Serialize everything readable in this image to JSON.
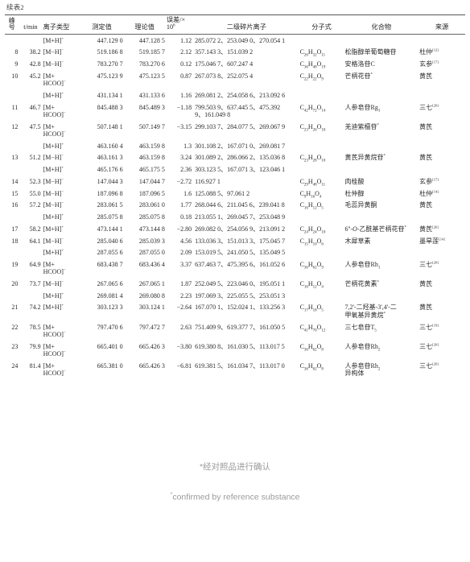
{
  "document": {
    "continuation_label": "续表2"
  },
  "table": {
    "headers": {
      "peak_no_line1": "峰",
      "peak_no_line2": "号",
      "retention_time": "t/min",
      "ion_type": "离子类型",
      "measured": "测定值",
      "theoretical": "理论值",
      "error_line1": "误差/×",
      "error_line2": "10",
      "error_exp": "6",
      "fragments": "二级碎片离子",
      "formula": "分子式",
      "compound": "化合物",
      "source": "来源"
    },
    "rows": [
      {
        "no": "",
        "rt": "",
        "ion": "[M+H]",
        "ion_sup": "+",
        "ion_line2": "",
        "measured": "447.129 0",
        "theoretical": "447.128 5",
        "error": "1.12",
        "fragments": "285.072 2、253.049 0、270.054 1",
        "formula": "",
        "formula_parts": [],
        "compound": "",
        "compound_star": false,
        "compound_line2": "",
        "source": "",
        "source_ref": ""
      },
      {
        "no": "8",
        "rt": "38.2",
        "ion": "[M−H]",
        "ion_sup": "−",
        "ion_line2": "",
        "measured": "519.186 8",
        "theoretical": "519.185 7",
        "error": "2.12",
        "fragments": "357.143 3、151.039 2",
        "formula_parts": [
          {
            "t": "C"
          },
          {
            "sub": "26"
          },
          {
            "t": "H"
          },
          {
            "sub": "32"
          },
          {
            "t": "O"
          },
          {
            "sub": "11"
          }
        ],
        "compound": "松脂醇单葡萄糖苷",
        "compound_star": false,
        "compound_line2": "",
        "source": "杜仲",
        "source_ref": "[12]"
      },
      {
        "no": "9",
        "rt": "42.8",
        "ion": "[M−H]",
        "ion_sup": "−",
        "ion_line2": "",
        "measured": "783.270 7",
        "theoretical": "783.270 6",
        "error": "0.12",
        "fragments": "175.046 7、607.247 4",
        "formula_parts": [
          {
            "t": "C"
          },
          {
            "sub": "36"
          },
          {
            "t": "H"
          },
          {
            "sub": "48"
          },
          {
            "t": "O"
          },
          {
            "sub": "19"
          }
        ],
        "compound": "安格洛苷C",
        "compound_star": false,
        "compound_line2": "",
        "source": "玄参",
        "source_ref": "[17]"
      },
      {
        "no": "10",
        "rt": "45.2",
        "ion": "[M+",
        "ion_sup": "",
        "ion_line2": "HCOO]",
        "ion_line2_sup": "−",
        "measured": "475.123 9",
        "theoretical": "475.123 5",
        "error": "0.87",
        "fragments": "267.073 8、252.075 4",
        "formula_parts": [
          {
            "t": "C"
          },
          {
            "sub": "22"
          },
          {
            "t": "H"
          },
          {
            "sub": "22"
          },
          {
            "t": "O"
          },
          {
            "sub": "9"
          }
        ],
        "compound": "芒柄花苷",
        "compound_star": true,
        "compound_line2": "",
        "source": "黄芪",
        "source_ref": ""
      },
      {
        "no": "",
        "rt": "",
        "ion": "[M+H]",
        "ion_sup": "+",
        "ion_line2": "",
        "measured": "431.134 1",
        "theoretical": "431.133 6",
        "error": "1.16",
        "fragments": "269.081 2、254.058 6、213.092 6",
        "formula_parts": [],
        "compound": "",
        "compound_star": false,
        "compound_line2": "",
        "source": "",
        "source_ref": ""
      },
      {
        "no": "11",
        "rt": "46.7",
        "ion": "[M+",
        "ion_sup": "",
        "ion_line2": "HCOO]",
        "ion_line2_sup": "−",
        "measured": "845.488 3",
        "theoretical": "845.489 3",
        "error": "−1.18",
        "fragments": "799.503 9、637.445 5、475.392",
        "fragments_line2": "9、161.049 8",
        "formula_parts": [
          {
            "t": "C"
          },
          {
            "sub": "42"
          },
          {
            "t": "H"
          },
          {
            "sub": "72"
          },
          {
            "t": "O"
          },
          {
            "sub": "14"
          }
        ],
        "compound": "人参皂苷Rg",
        "compound_sub": "1",
        "compound_star": false,
        "compound_line2": "",
        "source": "三七",
        "source_ref": "[20]"
      },
      {
        "no": "12",
        "rt": "47.5",
        "ion": "[M+",
        "ion_sup": "",
        "ion_line2": "HCOO]",
        "ion_line2_sup": "−",
        "measured": "507.148 1",
        "theoretical": "507.149 7",
        "error": "−3.15",
        "fragments": "299.103 7、284.077 5、269.067 9",
        "formula_parts": [
          {
            "t": "C"
          },
          {
            "sub": "23"
          },
          {
            "t": "H"
          },
          {
            "sub": "26"
          },
          {
            "t": "O"
          },
          {
            "sub": "10"
          }
        ],
        "compound": "羌迪紫檀苷",
        "compound_star": true,
        "compound_line2": "",
        "source": "黄芪",
        "source_ref": ""
      },
      {
        "no": "",
        "rt": "",
        "ion": "[M+H]",
        "ion_sup": "+",
        "ion_line2": "",
        "measured": "463.160 4",
        "theoretical": "463.159 8",
        "error": "1.3",
        "fragments": "301.108 2、167.071 0、269.081 7",
        "formula_parts": [],
        "compound": "",
        "compound_star": false,
        "compound_line2": "",
        "source": "",
        "source_ref": ""
      },
      {
        "no": "13",
        "rt": "51.2",
        "ion": "[M−H]",
        "ion_sup": "−",
        "ion_line2": "",
        "measured": "463.161 3",
        "theoretical": "463.159 8",
        "error": "3.24",
        "fragments": "301.089 2、286.066 2、135.036 8",
        "formula_parts": [
          {
            "t": "C"
          },
          {
            "sub": "23"
          },
          {
            "t": "H"
          },
          {
            "sub": "28"
          },
          {
            "t": "O"
          },
          {
            "sub": "10"
          }
        ],
        "compound": "黄芪异黄烷苷",
        "compound_star": true,
        "compound_line2": "",
        "source": "黄芪",
        "source_ref": ""
      },
      {
        "no": "",
        "rt": "",
        "ion": "[M+H]",
        "ion_sup": "+",
        "ion_line2": "",
        "measured": "465.176 6",
        "theoretical": "465.175 5",
        "error": "2.36",
        "fragments": "303.123 5、167.071 3、123.046 1",
        "formula_parts": [],
        "compound": "",
        "compound_star": false,
        "compound_line2": "",
        "source": "",
        "source_ref": ""
      },
      {
        "no": "14",
        "rt": "52.3",
        "ion": "[M−H]",
        "ion_sup": "−",
        "ion_line2": "",
        "measured": "147.044 3",
        "theoretical": "147.044 7",
        "error": "−2.72",
        "fragments": "116.927 1",
        "formula_parts": [
          {
            "t": "C"
          },
          {
            "sub": "29"
          },
          {
            "t": "H"
          },
          {
            "sub": "48"
          },
          {
            "t": "O"
          },
          {
            "sub": "11"
          }
        ],
        "compound": "肉桂酸",
        "compound_star": false,
        "compound_line2": "",
        "source": "玄参",
        "source_ref": "[17]"
      },
      {
        "no": "15",
        "rt": "55.0",
        "ion": "[M−H]",
        "ion_sup": "−",
        "ion_line2": "",
        "measured": "187.096 8",
        "theoretical": "187.096 5",
        "error": "1.6",
        "fragments": "125.088 5、97.061 2",
        "formula_parts": [
          {
            "t": "C"
          },
          {
            "sub": "9"
          },
          {
            "t": "H"
          },
          {
            "sub": "16"
          },
          {
            "t": "O"
          },
          {
            "sub": "4"
          }
        ],
        "compound": "杜仲醇",
        "compound_star": false,
        "compound_line2": "",
        "source": "杜仲",
        "source_ref": "[14]"
      },
      {
        "no": "16",
        "rt": "57.2",
        "ion": "[M−H]",
        "ion_sup": "−",
        "ion_line2": "",
        "measured": "283.061 5",
        "theoretical": "283.061 0",
        "error": "1.77",
        "fragments": "268.044 6、211.045 6、239.041 8",
        "formula_parts": [
          {
            "t": "C"
          },
          {
            "sub": "16"
          },
          {
            "t": "H"
          },
          {
            "sub": "12"
          },
          {
            "t": "O"
          },
          {
            "sub": "5"
          }
        ],
        "compound": "毛蕊异黄酮",
        "compound_star": false,
        "compound_line2": "",
        "source": "黄芪",
        "source_ref": ""
      },
      {
        "no": "",
        "rt": "",
        "ion": "[M+H]",
        "ion_sup": "+",
        "ion_line2": "",
        "measured": "285.075 8",
        "theoretical": "285.075 8",
        "error": "0.18",
        "fragments": "213.055 1、269.045 7、253.048 9",
        "formula_parts": [],
        "compound": "",
        "compound_star": false,
        "compound_line2": "",
        "source": "",
        "source_ref": ""
      },
      {
        "no": "17",
        "rt": "58.2",
        "ion": "[M+H]",
        "ion_sup": "+",
        "ion_line2": "",
        "measured": "473.144 1",
        "theoretical": "473.144 8",
        "error": "−2.80",
        "fragments": "269.082 0、254.056 9、213.091 2",
        "formula_parts": [
          {
            "t": "C"
          },
          {
            "sub": "24"
          },
          {
            "t": "H"
          },
          {
            "sub": "24"
          },
          {
            "t": "O"
          },
          {
            "sub": "10"
          }
        ],
        "compound_pre": "6''-",
        "compound_ital": "O",
        "compound": "-乙酰基芒柄花苷",
        "compound_star": true,
        "compound_line2": "",
        "source": "黄芪",
        "source_ref": "[26]"
      },
      {
        "no": "18",
        "rt": "64.1",
        "ion": "[M−H]",
        "ion_sup": "−",
        "ion_line2": "",
        "measured": "285.040 6",
        "theoretical": "285.039 3",
        "error": "4.56",
        "fragments": "133.036 3、151.013 3、175.045 7",
        "formula_parts": [
          {
            "t": "C"
          },
          {
            "sub": "15"
          },
          {
            "t": "H"
          },
          {
            "sub": "10"
          },
          {
            "t": "O"
          },
          {
            "sub": "6"
          }
        ],
        "compound": "木犀草素",
        "compound_star": false,
        "compound_line2": "",
        "source": "墨旱莲",
        "source_ref": "[14]"
      },
      {
        "no": "",
        "rt": "",
        "ion": "[M+H]",
        "ion_sup": "+",
        "ion_line2": "",
        "measured": "287.055 6",
        "theoretical": "287.055 0",
        "error": "2.09",
        "fragments": "153.019 5、241.050 5、135.049 5",
        "formula_parts": [],
        "compound": "",
        "compound_star": false,
        "compound_line2": "",
        "source": "",
        "source_ref": ""
      },
      {
        "no": "19",
        "rt": "64.9",
        "ion": "[M+",
        "ion_sup": "",
        "ion_line2": "HCOO]",
        "ion_line2_sup": "−",
        "measured": "683.438 7",
        "theoretical": "683.436 4",
        "error": "3.37",
        "fragments": "637.463 7、475.395 6、161.052 6",
        "formula_parts": [
          {
            "t": "C"
          },
          {
            "sub": "36"
          },
          {
            "t": "H"
          },
          {
            "sub": "62"
          },
          {
            "t": "O"
          },
          {
            "sub": "9"
          }
        ],
        "compound": "人参皂苷Rh",
        "compound_sub": "1",
        "compound_star": false,
        "compound_line2": "",
        "source": "三七",
        "source_ref": "[20]"
      },
      {
        "no": "20",
        "rt": "73.7",
        "ion": "[M−H]",
        "ion_sup": "−",
        "ion_line2": "",
        "measured": "267.065 6",
        "theoretical": "267.065 1",
        "error": "1.87",
        "fragments": "252.049 5、223.046 0、195.051 1",
        "formula_parts": [
          {
            "t": "C"
          },
          {
            "sub": "16"
          },
          {
            "t": "H"
          },
          {
            "sub": "12"
          },
          {
            "t": "O"
          },
          {
            "sub": "4"
          }
        ],
        "compound": "芒柄花黄素",
        "compound_star": true,
        "compound_line2": "",
        "source": "黄芪",
        "source_ref": ""
      },
      {
        "no": "",
        "rt": "",
        "ion": "[M+H]",
        "ion_sup": "+",
        "ion_line2": "",
        "measured": "269.081 4",
        "theoretical": "269.080 8",
        "error": "2.23",
        "fragments": "197.069 3、225.055 5、253.051 3",
        "formula_parts": [],
        "compound": "",
        "compound_star": false,
        "compound_line2": "",
        "source": "",
        "source_ref": ""
      },
      {
        "no": "21",
        "rt": "74.2",
        "ion": "[M+H]",
        "ion_sup": "+",
        "ion_line2": "",
        "measured": "303.123 3",
        "theoretical": "303.124 1",
        "error": "−2.64",
        "fragments": "167.070 1、152.024 1、133.256 3",
        "formula_parts": [
          {
            "t": "C"
          },
          {
            "sub": "17"
          },
          {
            "t": "H"
          },
          {
            "sub": "18"
          },
          {
            "t": "O"
          },
          {
            "sub": "5"
          }
        ],
        "compound": "7,2'-二羟基-3',4'-二",
        "compound_star": false,
        "compound_line2": "甲氧基异黄烷",
        "compound_line2_star": true,
        "source": "黄芪",
        "source_ref": ""
      },
      {
        "no": "22",
        "rt": "78.5",
        "ion": "[M+",
        "ion_sup": "",
        "ion_line2": "HCOO]",
        "ion_line2_sup": "−",
        "measured": "797.470 6",
        "theoretical": "797.472 7",
        "error": "2.63",
        "fragments": "751.409 9、619.377 7、161.050 5",
        "formula_parts": [
          {
            "t": "C"
          },
          {
            "sub": "41"
          },
          {
            "t": "H"
          },
          {
            "sub": "70"
          },
          {
            "t": "O"
          },
          {
            "sub": "12"
          }
        ],
        "compound": "三七皂苷T",
        "compound_sub": "5",
        "compound_star": false,
        "compound_line2": "",
        "source": "三七",
        "source_ref": "[19]"
      },
      {
        "no": "23",
        "rt": "79.9",
        "ion": "[M+",
        "ion_sup": "",
        "ion_line2": "HCOO]",
        "ion_line2_sup": "−",
        "measured": "665.401 0",
        "theoretical": "665.426 3",
        "error": "−3.80",
        "fragments": "619.380 8、161.030 5、113.017 5",
        "formula_parts": [
          {
            "t": "C"
          },
          {
            "sub": "36"
          },
          {
            "t": "H"
          },
          {
            "sub": "62"
          },
          {
            "t": "O"
          },
          {
            "sub": "8"
          }
        ],
        "compound": "人参皂苷Rh",
        "compound_sub": "2",
        "compound_star": false,
        "compound_line2": "",
        "source": "三七",
        "source_ref": "[20]"
      },
      {
        "no": "24",
        "rt": "81.4",
        "ion": "[M+",
        "ion_sup": "",
        "ion_line2": "HCOO]",
        "ion_line2_sup": "−",
        "measured": "665.381 0",
        "theoretical": "665.426 3",
        "error": "−6.81",
        "fragments": "619.381 5、161.034 7、113.017 0",
        "formula_parts": [
          {
            "t": "C"
          },
          {
            "sub": "36"
          },
          {
            "t": "H"
          },
          {
            "sub": "62"
          },
          {
            "t": "O"
          },
          {
            "sub": "8"
          }
        ],
        "compound": "人参皂苷Rh",
        "compound_sub": "2",
        "compound_star": false,
        "compound_line2": "异构体",
        "compound_line2_star": false,
        "source": "三七",
        "source_ref": "[20]"
      }
    ]
  },
  "footnotes": {
    "chinese": "*经对照品进行确认",
    "english_star": "*",
    "english": "confirmed by reference substance"
  }
}
